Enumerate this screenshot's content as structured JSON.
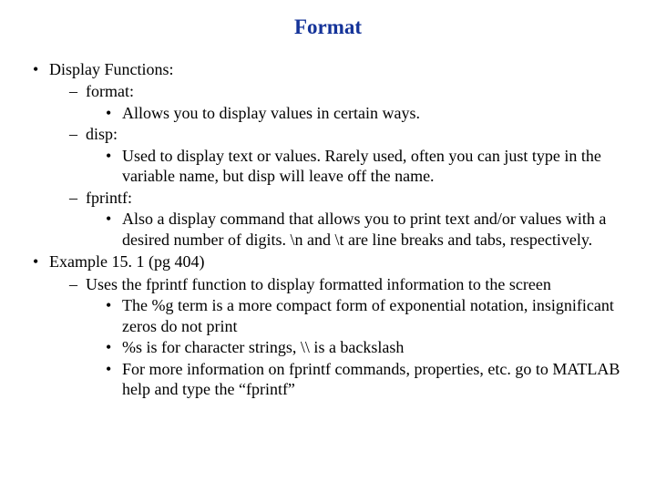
{
  "title": "Format",
  "bullets": [
    {
      "text": "Display Functions:",
      "children": [
        {
          "text": "format:",
          "children": [
            {
              "text": "Allows you to display values in certain ways."
            }
          ]
        },
        {
          "text": "disp:",
          "children": [
            {
              "text": "Used to display text or values. Rarely used, often you can just type in the variable name, but disp will leave off the name."
            }
          ]
        },
        {
          "text": "fprintf:",
          "children": [
            {
              "text": "Also a display command that allows you to print text and/or values with a desired number of digits. \\n and \\t are line breaks and tabs, respectively."
            }
          ]
        }
      ]
    },
    {
      "text": "Example 15. 1 (pg 404)",
      "children": [
        {
          "text": "Uses the fprintf function to display formatted information to the screen",
          "children": [
            {
              "text": "The %g term is a more compact form of exponential notation, insignificant zeros do not print"
            },
            {
              "text": "%s is for character strings, \\\\ is a backslash"
            },
            {
              "text": "For more information on fprintf commands, properties, etc. go to MATLAB help and type the “fprintf”"
            }
          ]
        }
      ]
    }
  ]
}
